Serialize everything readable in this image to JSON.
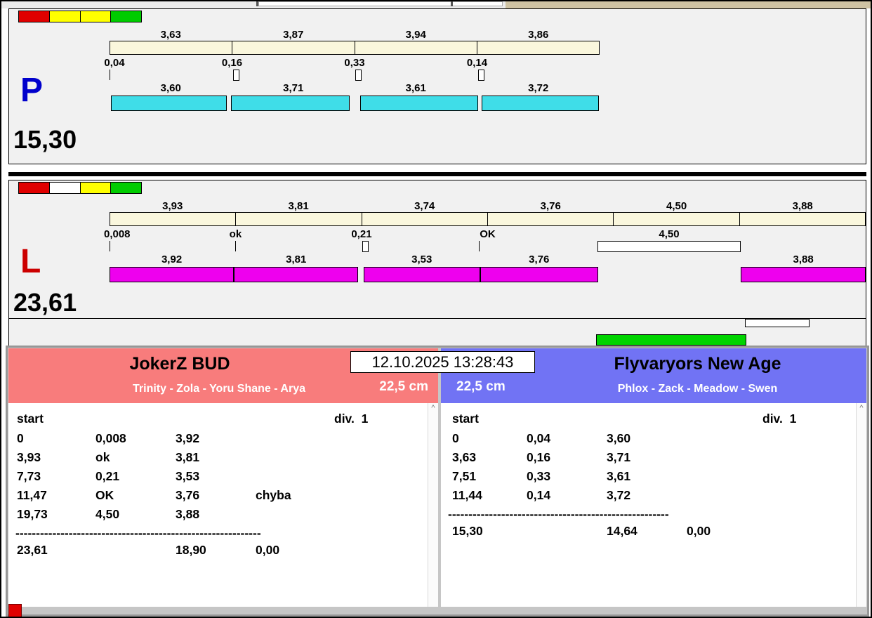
{
  "colors": {
    "cyan_bar": "#3fdde8",
    "magenta_bar": "#ee00ee",
    "left_header": "#f87c7c",
    "right_header": "#7173f4",
    "green_box": "#00d400"
  },
  "lane_p": {
    "label": "P",
    "total": "15,30",
    "lights": [
      "#e00000",
      "#ffff00",
      "#ffff00",
      "#00cc00"
    ],
    "segments": [
      {
        "top": "3,63",
        "split": "0,04",
        "bottom": "3,60"
      },
      {
        "top": "3,87",
        "split": "0,16",
        "bottom": "3,71"
      },
      {
        "top": "3,94",
        "split": "0,33",
        "bottom": "3,61"
      },
      {
        "top": "3,86",
        "split": "0,14",
        "bottom": "3,72"
      }
    ]
  },
  "lane_l": {
    "label": "L",
    "total": "23,61",
    "lights": [
      "#e00000",
      "#ffffff",
      "#ffff00",
      "#00cc00"
    ],
    "segments": [
      {
        "top": "3,93",
        "split": "0,008",
        "bottom": "3,92"
      },
      {
        "top": "3,81",
        "split": "ok",
        "bottom": "3,81"
      },
      {
        "top": "3,74",
        "split": "0,21",
        "bottom": "3,53"
      },
      {
        "top": "3,76",
        "split": "OK",
        "bottom": "3,76"
      },
      {
        "top": "4,50",
        "split": "4,50",
        "bottom": ""
      },
      {
        "top": "3,88",
        "split": "",
        "bottom": "3,88"
      }
    ]
  },
  "datetime": "12.10.2025 13:28:43",
  "ui": {
    "scroll_up": "^"
  },
  "team_left": {
    "name": "JokerZ BUD",
    "members": "Trinity - Zola - Yoru Shane - Arya",
    "barrier": "22,5 cm",
    "col_start": "start",
    "col_div": "div.  1",
    "rows": [
      {
        "c1": "0",
        "c2": "0,008",
        "c3": "3,92",
        "c4": ""
      },
      {
        "c1": "3,93",
        "c2": "ok",
        "c3": "3,81",
        "c4": ""
      },
      {
        "c1": "7,73",
        "c2": "0,21",
        "c3": "3,53",
        "c4": ""
      },
      {
        "c1": "11,47",
        "c2": "OK",
        "c3": "3,76",
        "c4": "chyba"
      },
      {
        "c1": "19,73",
        "c2": "4,50",
        "c3": "3,88",
        "c4": ""
      }
    ],
    "separator": "------------------------------------------------------------",
    "total": {
      "c1": "23,61",
      "c3": "18,90",
      "c4": "0,00"
    }
  },
  "team_right": {
    "name": "Flyvaryors New Age",
    "members": "Phlox - Zack - Meadow - Swen",
    "barrier": "22,5 cm",
    "col_start": "start",
    "col_div": "div.  1",
    "rows": [
      {
        "c1": "0",
        "c2": "0,04",
        "c3": "3,60",
        "c4": ""
      },
      {
        "c1": "3,63",
        "c2": "0,16",
        "c3": "3,71",
        "c4": ""
      },
      {
        "c1": "7,51",
        "c2": "0,33",
        "c3": "3,61",
        "c4": ""
      },
      {
        "c1": "11,44",
        "c2": "0,14",
        "c3": "3,72",
        "c4": ""
      }
    ],
    "separator": "------------------------------------------------------",
    "total": {
      "c1": "15,30",
      "c3": "14,64",
      "c4": "0,00"
    }
  }
}
